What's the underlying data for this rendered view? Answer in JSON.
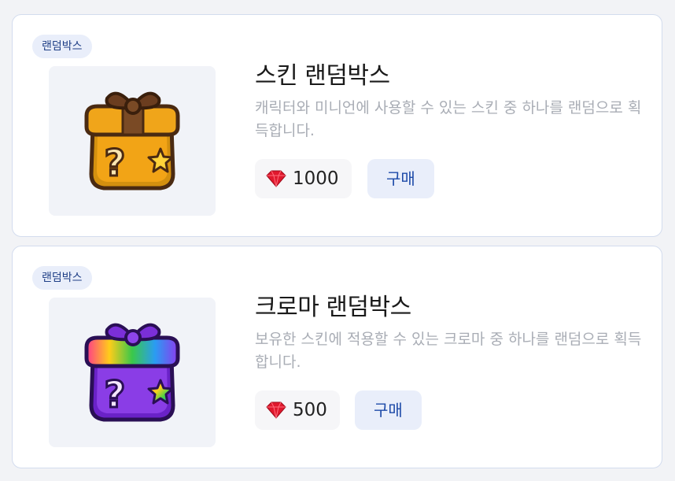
{
  "items": [
    {
      "tag": "랜덤박스",
      "title": "스킨 랜덤박스",
      "description": "캐릭터와 미니언에 사용할 수 있는 스킨 중 하나를 랜덤으로 획득합니다.",
      "price": "1000",
      "buy_label": "구매",
      "box_icon": "skin-random-box-icon"
    },
    {
      "tag": "랜덤박스",
      "title": "크로마 랜덤박스",
      "description": "보유한 스킨에 적용할 수 있는 크로마 중 하나를 랜덤으로 획득합니다.",
      "price": "500",
      "buy_label": "구매",
      "box_icon": "chroma-random-box-icon"
    }
  ],
  "currency_icon": "ruby-gem-icon",
  "colors": {
    "accent": "#1d4aa8",
    "tag_bg": "#e9eefa",
    "gem": "#e0182d"
  }
}
